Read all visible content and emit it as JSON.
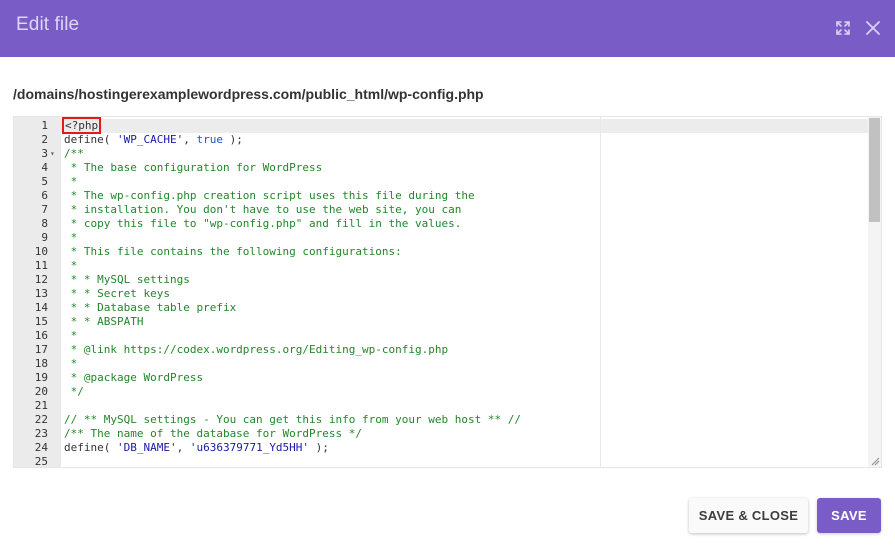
{
  "dialog": {
    "title": "Edit file",
    "header_color": "#7a5cc7",
    "icons": [
      "expand-icon",
      "close-icon"
    ]
  },
  "file_path": "/domains/hostingerexamplewordpress.com/public_html/wp-config.php",
  "editor": {
    "lines": [
      {
        "n": "1",
        "segs": [
          {
            "t": "<?php",
            "c": "tag"
          }
        ]
      },
      {
        "n": "2",
        "segs": [
          {
            "t": "define( ",
            "c": "fn"
          },
          {
            "t": "'WP_CACHE'",
            "c": "str"
          },
          {
            "t": ", ",
            "c": "fn"
          },
          {
            "t": "true",
            "c": "kw"
          },
          {
            "t": " );",
            "c": "fn"
          }
        ]
      },
      {
        "n": "3",
        "fold": true,
        "segs": [
          {
            "t": "/**",
            "c": "comment"
          }
        ]
      },
      {
        "n": "4",
        "segs": [
          {
            "t": " * The base configuration for WordPress",
            "c": "comment"
          }
        ]
      },
      {
        "n": "5",
        "segs": [
          {
            "t": " *",
            "c": "comment"
          }
        ]
      },
      {
        "n": "6",
        "segs": [
          {
            "t": " * The wp-config.php creation script uses this file during the",
            "c": "comment"
          }
        ]
      },
      {
        "n": "7",
        "segs": [
          {
            "t": " * installation. You don't have to use the web site, you can",
            "c": "comment"
          }
        ]
      },
      {
        "n": "8",
        "segs": [
          {
            "t": " * copy this file to \"wp-config.php\" and fill in the values.",
            "c": "comment"
          }
        ]
      },
      {
        "n": "9",
        "segs": [
          {
            "t": " *",
            "c": "comment"
          }
        ]
      },
      {
        "n": "10",
        "segs": [
          {
            "t": " * This file contains the following configurations:",
            "c": "comment"
          }
        ]
      },
      {
        "n": "11",
        "segs": [
          {
            "t": " *",
            "c": "comment"
          }
        ]
      },
      {
        "n": "12",
        "segs": [
          {
            "t": " * * MySQL settings",
            "c": "comment"
          }
        ]
      },
      {
        "n": "13",
        "segs": [
          {
            "t": " * * Secret keys",
            "c": "comment"
          }
        ]
      },
      {
        "n": "14",
        "segs": [
          {
            "t": " * * Database table prefix",
            "c": "comment"
          }
        ]
      },
      {
        "n": "15",
        "segs": [
          {
            "t": " * * ABSPATH",
            "c": "comment"
          }
        ]
      },
      {
        "n": "16",
        "segs": [
          {
            "t": " *",
            "c": "comment"
          }
        ]
      },
      {
        "n": "17",
        "segs": [
          {
            "t": " * @link https://codex.wordpress.org/Editing_wp-config.php",
            "c": "comment"
          }
        ]
      },
      {
        "n": "18",
        "segs": [
          {
            "t": " *",
            "c": "comment"
          }
        ]
      },
      {
        "n": "19",
        "segs": [
          {
            "t": " * @package WordPress",
            "c": "comment"
          }
        ]
      },
      {
        "n": "20",
        "segs": [
          {
            "t": " */",
            "c": "comment"
          }
        ]
      },
      {
        "n": "21",
        "segs": []
      },
      {
        "n": "22",
        "segs": [
          {
            "t": "// ** MySQL settings - You can get this info from your web host ** //",
            "c": "comment"
          }
        ]
      },
      {
        "n": "23",
        "segs": [
          {
            "t": "/** The name of the database for WordPress */",
            "c": "comment"
          }
        ]
      },
      {
        "n": "24",
        "segs": [
          {
            "t": "define( ",
            "c": "fn"
          },
          {
            "t": "'DB_NAME'",
            "c": "str"
          },
          {
            "t": ", ",
            "c": "fn"
          },
          {
            "t": "'u636379771_Yd5HH'",
            "c": "str"
          },
          {
            "t": " );",
            "c": "fn"
          }
        ]
      },
      {
        "n": "25",
        "segs": []
      }
    ]
  },
  "buttons": {
    "save_close_label": "SAVE & CLOSE",
    "save_label": "SAVE"
  }
}
